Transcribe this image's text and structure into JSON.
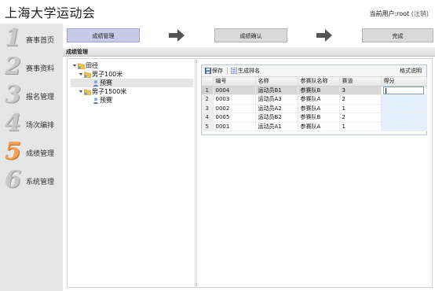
{
  "app": {
    "title": "上海大学运动会"
  },
  "user": {
    "prefix": "当前用户:",
    "name": "root",
    "logout": "(注销)"
  },
  "sidebar": {
    "items": [
      {
        "num": "1",
        "label": "赛事首页",
        "active": false
      },
      {
        "num": "2",
        "label": "赛事资料",
        "active": false
      },
      {
        "num": "3",
        "label": "报名管理",
        "active": false
      },
      {
        "num": "4",
        "label": "场次编排",
        "active": false
      },
      {
        "num": "5",
        "label": "成绩管理",
        "active": true
      },
      {
        "num": "6",
        "label": "系统管理",
        "active": false
      }
    ]
  },
  "steps": [
    "成绩管理",
    "成绩确认",
    "完成"
  ],
  "panel": {
    "title": "成绩管理"
  },
  "tree": {
    "root": "田径",
    "children": [
      {
        "label": "男子100米",
        "children": [
          "预赛"
        ]
      },
      {
        "label": "男子1500米",
        "children": [
          "预赛"
        ]
      }
    ]
  },
  "grid": {
    "toolbar": {
      "save": "保存",
      "rank": "生成排名",
      "help": "格式说明"
    },
    "columns": [
      "编号",
      "名称",
      "参赛队名称",
      "赛道",
      "得分"
    ],
    "rows": [
      {
        "rn": "1",
        "id": "0004",
        "name": "运动员B1",
        "team": "参赛队B",
        "lane": "3",
        "score": ""
      },
      {
        "rn": "2",
        "id": "0003",
        "name": "运动员A3",
        "team": "参赛队A",
        "lane": "2",
        "score": ""
      },
      {
        "rn": "3",
        "id": "0002",
        "name": "运动员A2",
        "team": "参赛队A",
        "lane": "1",
        "score": ""
      },
      {
        "rn": "4",
        "id": "0005",
        "name": "运动员B2",
        "team": "参赛队B",
        "lane": "2",
        "score": ""
      },
      {
        "rn": "5",
        "id": "0001",
        "name": "运动员A1",
        "team": "参赛队A",
        "lane": "1",
        "score": ""
      }
    ]
  },
  "colors": {
    "active_step": "#c7cbe8",
    "active_nav": "#f5a052",
    "score_cell": "#e3efff"
  }
}
